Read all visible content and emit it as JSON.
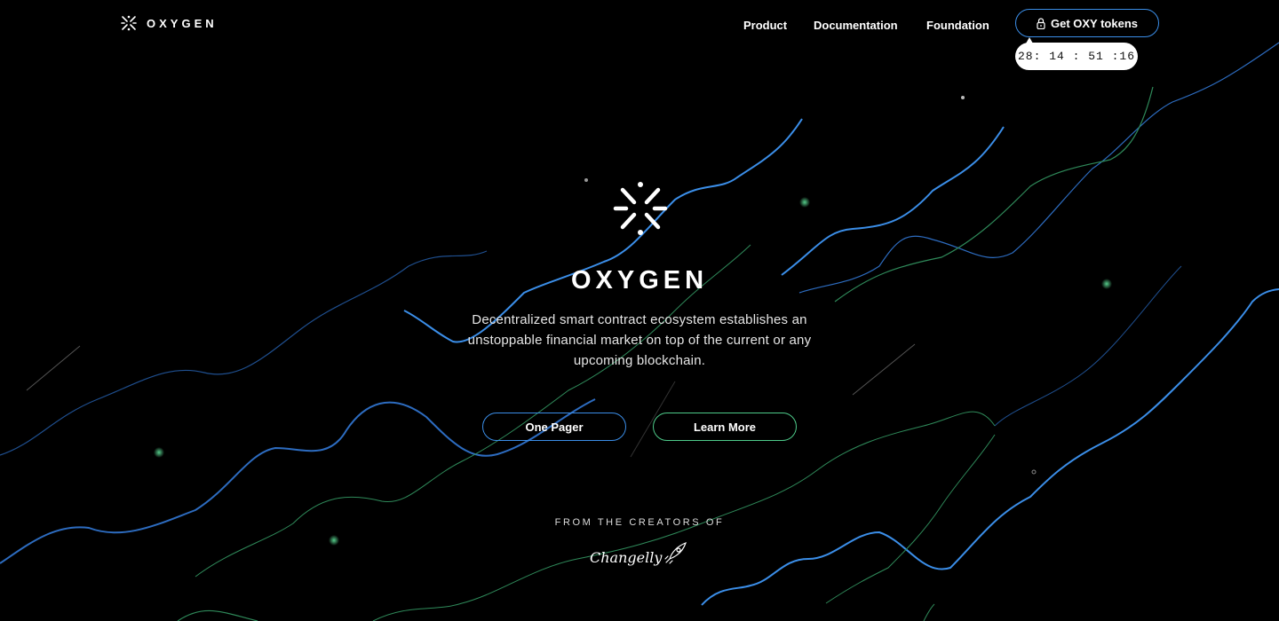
{
  "header": {
    "brand": "OXYGEN",
    "nav": [
      {
        "label": "Product"
      },
      {
        "label": "Documentation"
      },
      {
        "label": "Foundation"
      }
    ],
    "cta_label": "Get OXY tokens",
    "timer": "28: 14 : 51 :16"
  },
  "hero": {
    "title": "OXYGEN",
    "subtitle": "Decentralized smart contract ecosystem establishes an unstoppable financial market on top of the current or any upcoming blockchain.",
    "buttons": [
      {
        "label": "One Pager"
      },
      {
        "label": "Learn More"
      }
    ]
  },
  "creators": {
    "label": "FROM THE CREATORS OF",
    "partner": "Changelly"
  },
  "colors": {
    "background": "#000000",
    "accent_blue": "#3b8ee8",
    "accent_green": "#4ecb8a",
    "text": "#ffffff"
  },
  "icons": [
    "oxygen-logo-icon",
    "lock-icon",
    "rocket-icon"
  ]
}
